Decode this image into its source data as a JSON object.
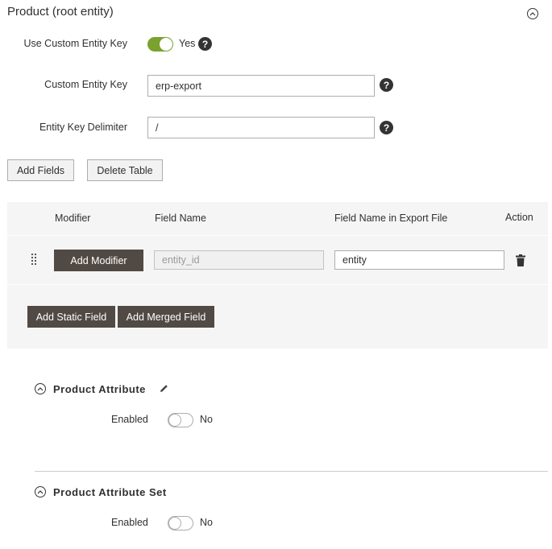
{
  "section": {
    "title": "Product (root entity)"
  },
  "custom_key": {
    "use_label": "Use Custom Entity Key",
    "use_value": "Yes",
    "key_label": "Custom Entity Key",
    "key_value": "erp-export",
    "delimiter_label": "Entity Key Delimiter",
    "delimiter_value": "/",
    "help_glyph": "?"
  },
  "actions": {
    "add_fields": "Add Fields",
    "delete_table": "Delete Table"
  },
  "table": {
    "headers": [
      "Modifier",
      "Field Name",
      "Field Name in Export File",
      "Action"
    ],
    "rows": [
      {
        "modifier_button": "Add Modifier",
        "field_name": "entity_id",
        "export_name": "entity"
      }
    ],
    "add_static": "Add Static Field",
    "add_merged": "Add Merged Field"
  },
  "subsections": [
    {
      "title": "Product Attribute",
      "enabled_label": "Enabled",
      "enabled_value": "No"
    },
    {
      "title": "Product Attribute Set",
      "enabled_label": "Enabled",
      "enabled_value": "No"
    }
  ],
  "colors": {
    "toggle_on": "#79a22e",
    "dark_button": "#514943",
    "table_bg": "#f5f5f5"
  },
  "icons": [
    "chevron-up-icon",
    "help-icon",
    "drag-handle-icon",
    "trash-icon",
    "pencil-icon"
  ]
}
